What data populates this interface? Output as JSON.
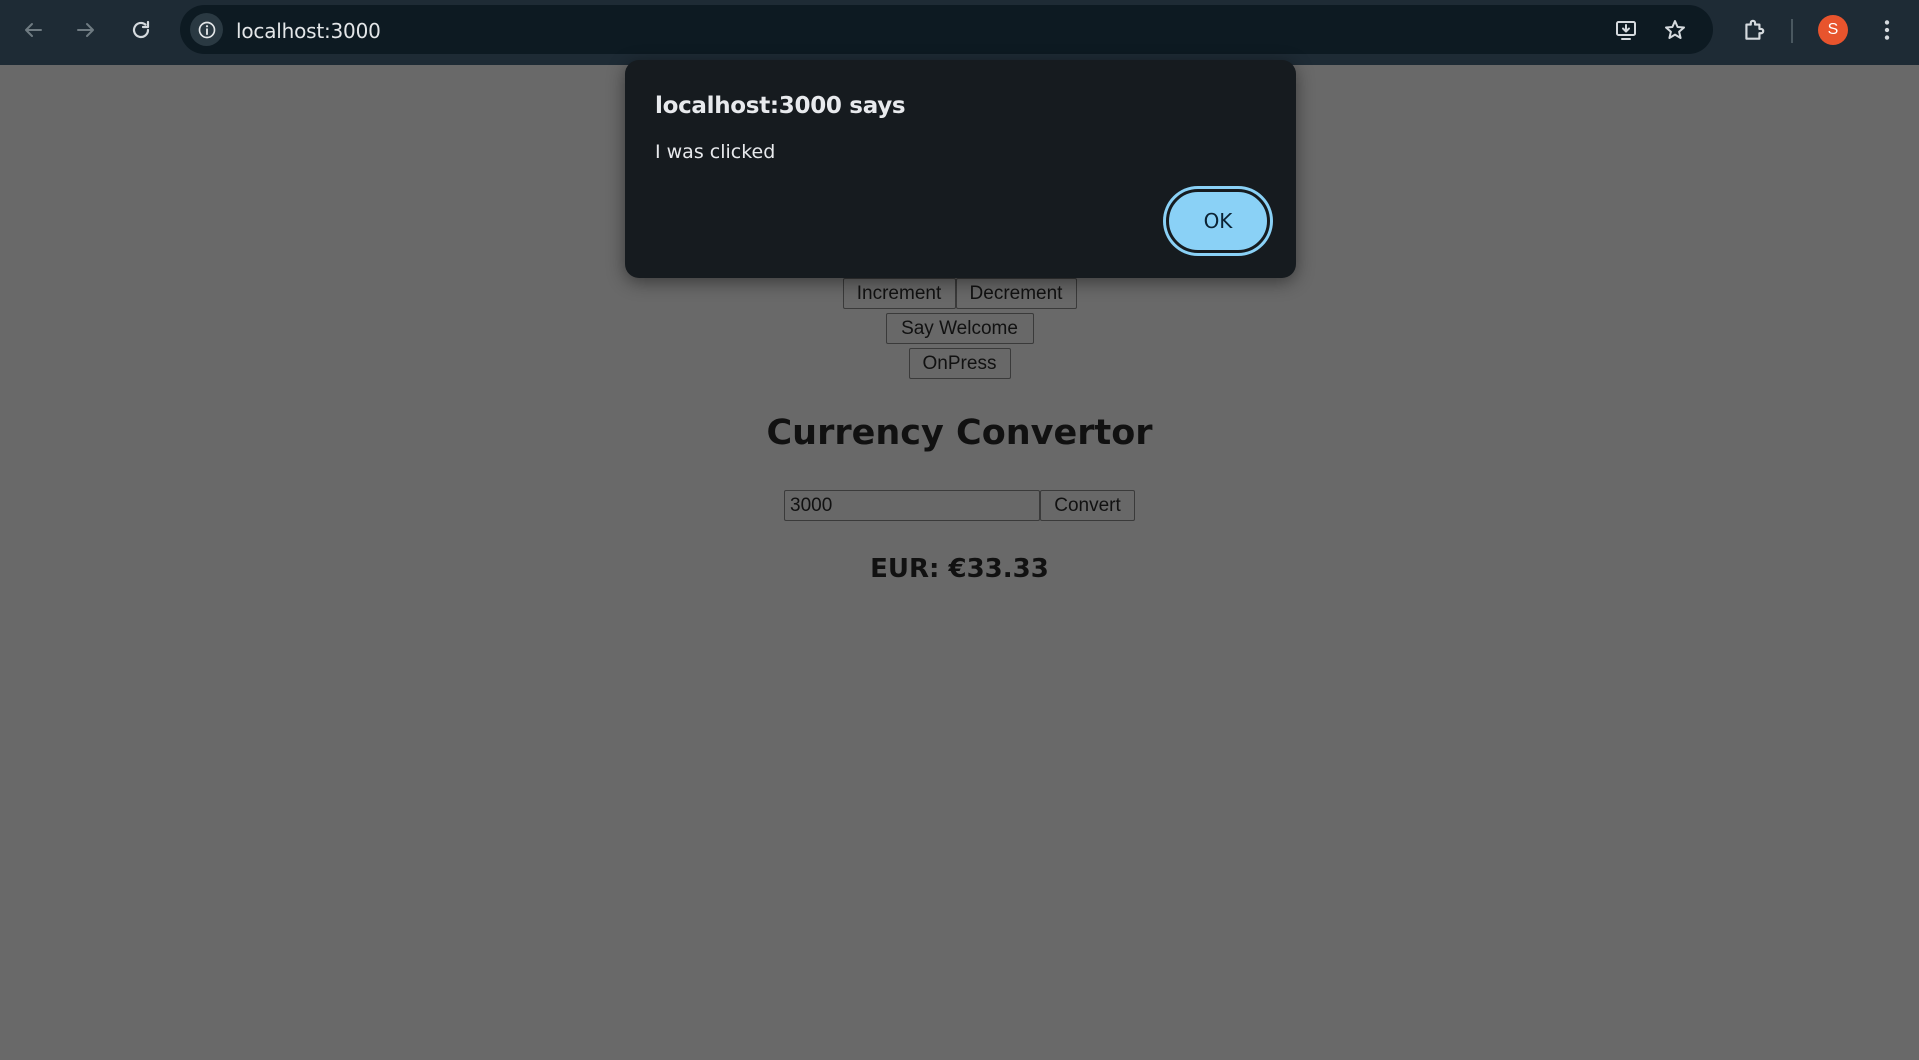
{
  "browser": {
    "url": "localhost:3000",
    "avatar_initial": "S",
    "icons": {
      "back": "arrow-left-icon",
      "forward": "arrow-right-icon",
      "reload": "reload-icon",
      "site_info": "info-icon",
      "install": "install-app-icon",
      "bookmark": "star-icon",
      "extensions": "puzzle-icon",
      "menu": "kebab-menu-icon"
    },
    "colors": {
      "toolbar": "#1e2b35",
      "omnibox": "#0d1a22",
      "avatar": "#e8542d"
    }
  },
  "page": {
    "buttons": {
      "increment": "Increment",
      "decrement": "Decrement",
      "say_welcome": "Say Welcome",
      "on_press": "OnPress"
    },
    "converter": {
      "heading": "Currency Convertor",
      "amount_value": "3000",
      "convert_label": "Convert",
      "result": "EUR: €33.33"
    },
    "colors": {
      "dimmed_background": "#696969"
    }
  },
  "dialog": {
    "title": "localhost:3000 says",
    "message": "I was clicked",
    "ok_label": "OK",
    "colors": {
      "background": "#161b1f",
      "ok_button": "#8ad1f6"
    }
  }
}
